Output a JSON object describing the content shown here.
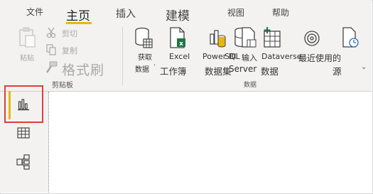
{
  "tabs": [
    {
      "label": "文件"
    },
    {
      "label": "主页"
    },
    {
      "label": "插入"
    },
    {
      "label": "建模"
    },
    {
      "label": "视图"
    },
    {
      "label": "帮助"
    }
  ],
  "clipboard": {
    "paste": "粘贴",
    "cut": "剪切",
    "copy": "复制",
    "format_painter": "格式刷",
    "group_title": "剪贴板"
  },
  "data_group": {
    "get_data_line1": "获取",
    "get_data_line2": "数据",
    "excel_line1": "Excel",
    "excel_line2": "工作簿",
    "powerbi_line1": "Power BI",
    "powerbi_line2": "数据集",
    "sql_line1": "SQL",
    "sql_line2": "Server",
    "input_line1": "输入",
    "input_line2": "数据",
    "dataverse": "Dataverse",
    "recent_line1": "最近使用的",
    "recent_line2": "源",
    "group_title": "数据"
  },
  "colors": {
    "accent": "#e6b800",
    "highlight": "#e03c3c",
    "ribbon_bg": "#f3f2f1",
    "excel_green": "#217346"
  },
  "left_nav": [
    {
      "icon": "report-view-icon",
      "active": true
    },
    {
      "icon": "data-view-icon",
      "active": false
    },
    {
      "icon": "model-view-icon",
      "active": false
    }
  ]
}
